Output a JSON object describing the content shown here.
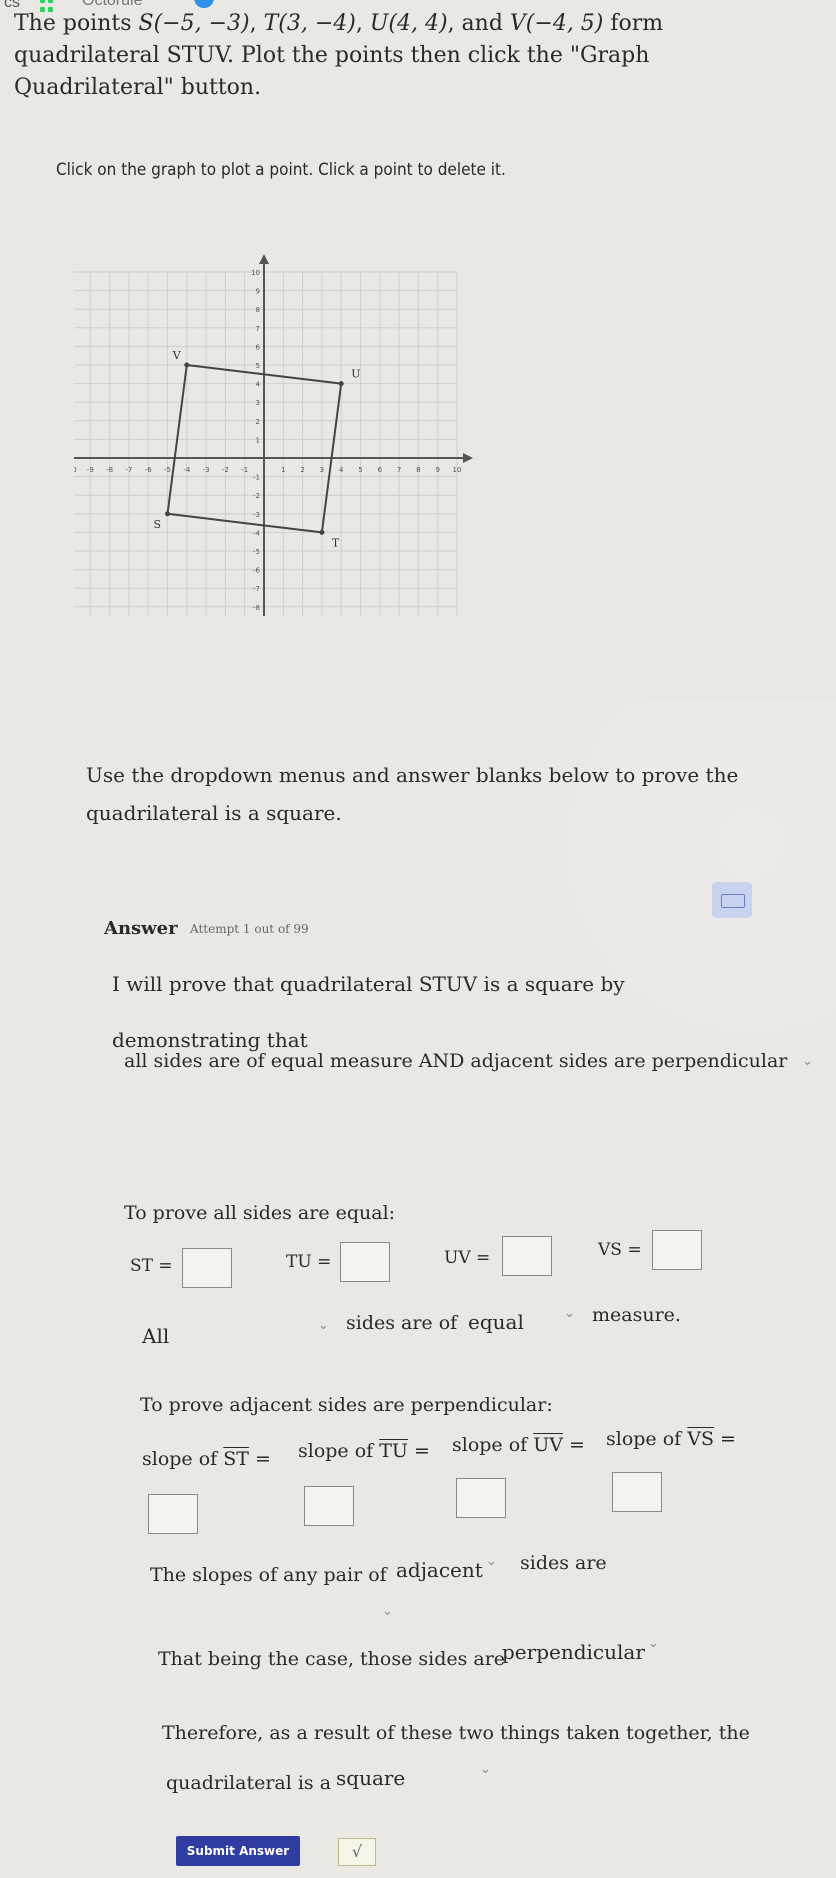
{
  "topbar": {
    "partial_left": "cs",
    "brand": "Octorule"
  },
  "problem": {
    "prefix": "The points ",
    "S": "S(−5, −3)",
    "T": "T(3, −4)",
    "U": "U(4, 4)",
    "V": "V(−4, 5)",
    "and": ", and ",
    "line1_end": " form",
    "line2": "quadrilateral STUV. Plot the points then click the \"Graph",
    "line3": "Quadrilateral\" button."
  },
  "instruction": "Click on the graph to plot a point. Click a point to delete it.",
  "graph": {
    "range": [
      -10,
      10
    ],
    "x_ticks": [
      "-10",
      "-9",
      "-8",
      "-7",
      "-6",
      "-5",
      "-4",
      "-3",
      "-2",
      "-1",
      "1",
      "2",
      "3",
      "4",
      "5",
      "6",
      "7",
      "8",
      "9",
      "10"
    ],
    "y_ticks": [
      "-10",
      "-9",
      "-8",
      "-7",
      "-6",
      "-5",
      "-4",
      "-3",
      "-2",
      "-1",
      "1",
      "2",
      "3",
      "4",
      "5",
      "6",
      "7",
      "8",
      "9",
      "10"
    ],
    "points": [
      {
        "label": "S",
        "x": -5,
        "y": -3
      },
      {
        "label": "T",
        "x": 3,
        "y": -4
      },
      {
        "label": "U",
        "x": 4,
        "y": 4
      },
      {
        "label": "V",
        "x": -4,
        "y": 5
      }
    ],
    "quad_order": [
      "S",
      "T",
      "U",
      "V"
    ]
  },
  "prompt": {
    "line1": "Use the dropdown menus and answer blanks below to prove the",
    "line2": "quadrilateral is a square."
  },
  "answer": {
    "header": "Answer",
    "attempt": "Attempt 1 out of 99",
    "intro1": "I will prove that quadrilateral STUV is a square by",
    "intro2": "demonstrating that",
    "method_select": "all sides are of equal measure AND adjacent sides are perpendicular",
    "equal_heading": "To prove all sides are equal:",
    "st_label": "ST =",
    "tu_label": "TU =",
    "uv_label": "UV =",
    "vs_label": "VS =",
    "all_select": "All",
    "sides_are_of": "sides are of",
    "equal_select": "equal",
    "measure": "measure.",
    "perp_heading": "To prove adjacent sides are perpendicular:",
    "slope_of": "slope of",
    "seg_st": "ST",
    "seg_tu": "TU",
    "seg_uv": "UV",
    "seg_vs": "VS",
    "eq": "=",
    "slopes_pair": "The slopes of any pair of",
    "adjacent_select": "adjacent",
    "sides_are": "sides are",
    "that_being": "That being the case, those sides are",
    "perp_select": "perpendicular",
    "therefore1": "Therefore, as a result of these two things taken together, the",
    "therefore2": "quadrilateral is a",
    "square_select": "square",
    "submit": "Submit Answer",
    "check_symbol": "√"
  }
}
